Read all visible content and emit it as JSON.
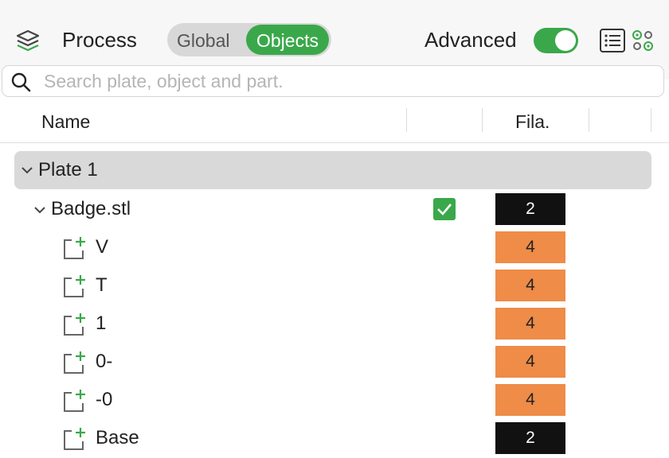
{
  "header": {
    "title": "Process",
    "segment": {
      "global_label": "Global",
      "objects_label": "Objects",
      "selected": "Objects"
    },
    "advanced_label": "Advanced",
    "advanced_on": true
  },
  "search": {
    "placeholder": "Search plate, object and part."
  },
  "columns": {
    "name": "Name",
    "filament": "Fila."
  },
  "tree": {
    "plate": {
      "label": "Plate 1",
      "expanded": true
    },
    "object": {
      "label": "Badge.stl",
      "expanded": true,
      "checked": true,
      "filament": "2"
    },
    "parts": [
      {
        "label": "V",
        "filament": "4"
      },
      {
        "label": "T",
        "filament": "4"
      },
      {
        "label": "1",
        "filament": "4"
      },
      {
        "label": "0-",
        "filament": "4"
      },
      {
        "label": "-0",
        "filament": "4"
      },
      {
        "label": "Base",
        "filament": "2"
      }
    ]
  },
  "filament_colors": {
    "2": "#111111",
    "4": "#ee8c48"
  },
  "filament_text_colors": {
    "2": "#ffffff",
    "4": "#222222"
  },
  "colors": {
    "accent": "#3aa84a"
  }
}
